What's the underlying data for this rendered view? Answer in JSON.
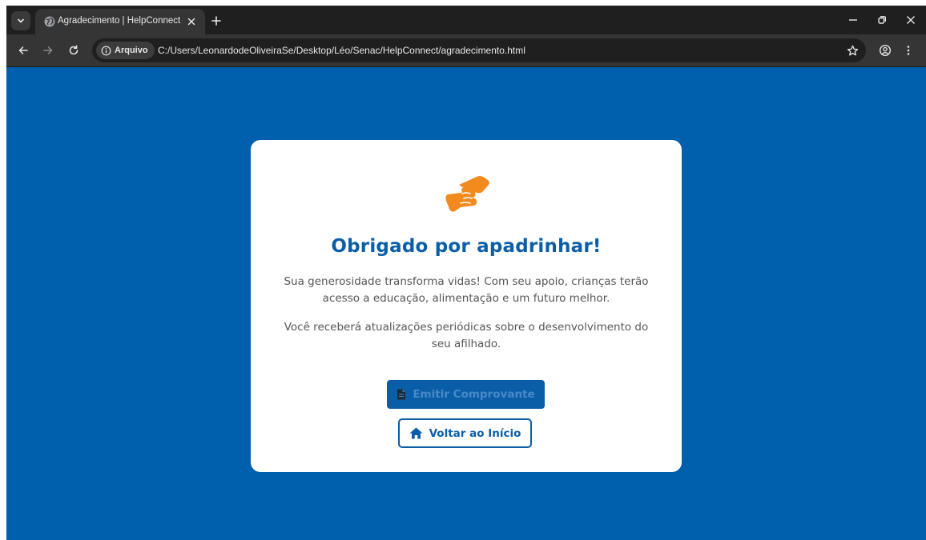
{
  "browser": {
    "tab_title": "Agradecimento | HelpConnect",
    "site_chip_label": "Arquivo",
    "url": "C:/Users/LeonardodeOliveiraSe/Desktop/Léo/Senac/HelpConnect/agradecimento.html",
    "icons": {
      "tab_search": "chevron-down-icon",
      "favicon": "globe-icon",
      "tab_close": "close-icon",
      "new_tab": "plus-icon",
      "minimize": "minimize-icon",
      "restore": "restore-icon",
      "window_close": "close-icon",
      "back": "arrow-left-icon",
      "forward": "arrow-right-icon",
      "reload": "reload-icon",
      "site_info": "info-icon",
      "bookmark": "star-icon",
      "profile": "profile-icon",
      "menu": "more-vertical-icon"
    }
  },
  "page": {
    "background_color": "#0060ae",
    "card": {
      "icon": "handshake-icon",
      "icon_color": "#f28a1e",
      "title": "Obrigado por apadrinhar!",
      "title_color": "#0a5ea8",
      "paragraph_1": "Sua generosidade transforma vidas! Com seu apoio, crianças terão acesso a educação, alimentação e um futuro melhor.",
      "paragraph_2": "Você receberá atualizações periódicas sobre o desenvolvimento do seu afilhado.",
      "primary_button": {
        "label": "Emitir Comprovante",
        "icon": "file-icon"
      },
      "secondary_button": {
        "label": "Voltar ao Início",
        "icon": "home-icon"
      }
    }
  }
}
